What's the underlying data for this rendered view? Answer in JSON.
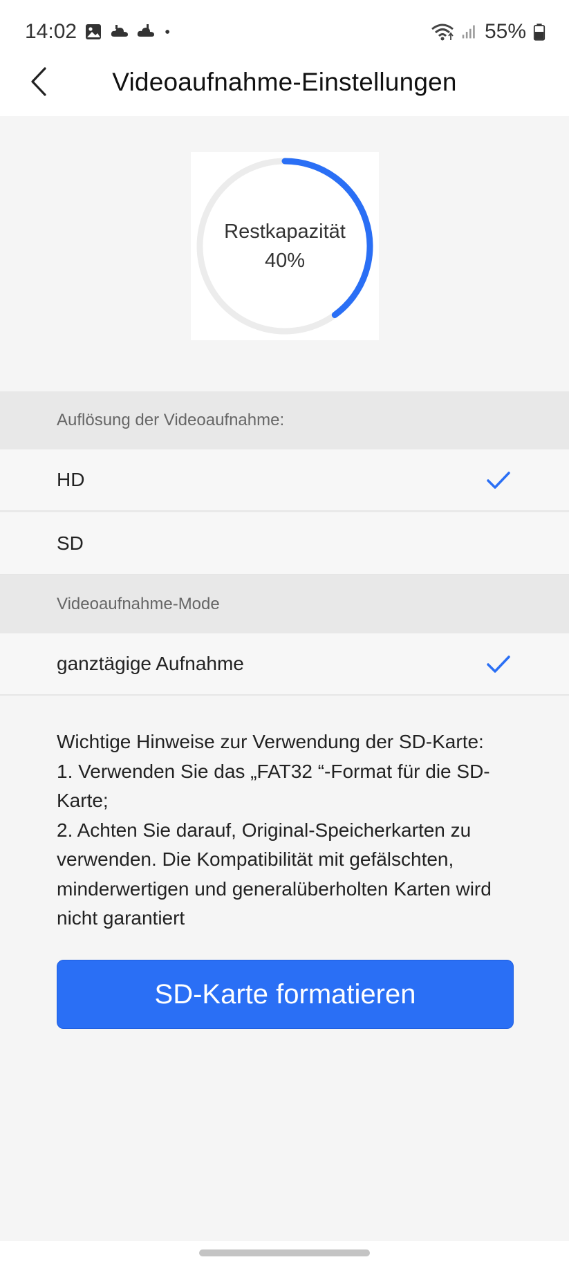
{
  "status_bar": {
    "time": "14:02",
    "battery": "55%",
    "icons": [
      "gallery-icon",
      "cloud-icon",
      "cloud-icon",
      "dot-icon",
      "wifi-icon",
      "signal-icon",
      "battery-icon"
    ]
  },
  "header": {
    "title": "Videoaufnahme-Einstellungen",
    "back_icon": "chevron-left-icon"
  },
  "capacity": {
    "label": "Restkapazität",
    "value_text": "40%",
    "fraction": 0.4,
    "track_color": "#ececec",
    "progress_color": "#2a6ff5"
  },
  "resolution": {
    "header": "Auflösung der Videoaufnahme:",
    "options": [
      {
        "label": "HD",
        "selected": true
      },
      {
        "label": "SD",
        "selected": false
      }
    ]
  },
  "mode": {
    "header": "Videoaufnahme-Mode",
    "options": [
      {
        "label": "ganztägige Aufnahme",
        "selected": true
      }
    ]
  },
  "notes": {
    "lines": [
      "Wichtige Hinweise zur Verwendung der SD-Karte:",
      "1. Verwenden Sie das „FAT32 “-Format für die SD-Karte;",
      "2. Achten Sie darauf, Original-Speicherkarten zu verwenden. Die Kompatibilität mit gefälschten, minderwertigen und generalüberholten Karten wird nicht garantiert"
    ]
  },
  "format_button": {
    "label": "SD-Karte formatieren",
    "color": "#2a6ff5"
  },
  "accent_color": "#2a6ff5"
}
